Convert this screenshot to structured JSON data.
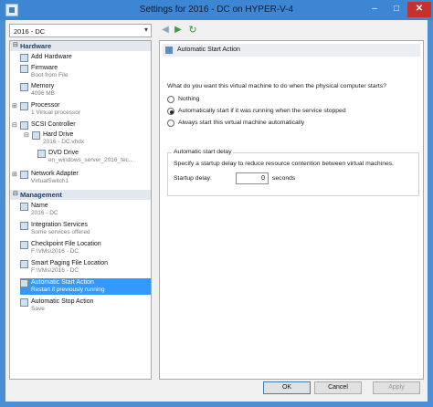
{
  "window": {
    "title": "Settings for 2016 - DC on HYPER-V-4",
    "minimize": "–",
    "maximize": "□",
    "close": "✕"
  },
  "vm_selector": {
    "value": "2016 - DC",
    "arrow": "▾"
  },
  "nav": {
    "back": "◀",
    "forward": "▶",
    "refresh": "↻"
  },
  "tree": {
    "hardware_header": "Hardware",
    "management_header": "Management",
    "collapse_glyph": "⊟",
    "expand_glyph": "⊞",
    "hardware": [
      {
        "title": "Add Hardware",
        "sub": ""
      },
      {
        "title": "Firmware",
        "sub": "Boot from File"
      },
      {
        "title": "Memory",
        "sub": "4096 MB"
      },
      {
        "title": "Processor",
        "sub": "1 Virtual processor"
      },
      {
        "title": "SCSI Controller",
        "sub": ""
      },
      {
        "title": "Hard Drive",
        "sub": "2016 - DC.vhdx"
      },
      {
        "title": "DVD Drive",
        "sub": "en_windows_server_2016_tec..."
      },
      {
        "title": "Network Adapter",
        "sub": "VirtualSwitch1"
      }
    ],
    "management": [
      {
        "title": "Name",
        "sub": "2016 - DC"
      },
      {
        "title": "Integration Services",
        "sub": "Some services offered"
      },
      {
        "title": "Checkpoint File Location",
        "sub": "F:\\VMs\\2016 - DC"
      },
      {
        "title": "Smart Paging File Location",
        "sub": "F:\\VMs\\2016 - DC"
      },
      {
        "title": "Automatic Start Action",
        "sub": "Restart if previously running"
      },
      {
        "title": "Automatic Stop Action",
        "sub": "Save"
      }
    ]
  },
  "panel": {
    "header": "Automatic Start Action",
    "question": "What do you want this virtual machine to do when the physical computer starts?",
    "options": [
      {
        "label": "Nothing",
        "selected": false
      },
      {
        "label": "Automatically start if it was running when the service stopped",
        "selected": true
      },
      {
        "label": "Always start this virtual machine automatically",
        "selected": false
      }
    ],
    "delay_group_title": "Automatic start delay",
    "delay_desc": "Specify a startup delay to reduce resource contention between virtual machines.",
    "delay_label": "Startup delay:",
    "delay_value": "0",
    "delay_unit": "seconds"
  },
  "buttons": {
    "ok": "OK",
    "cancel": "Cancel",
    "apply": "Apply"
  },
  "colors": {
    "titlebar": "#3d86d3",
    "selection": "#3399ff",
    "close": "#c7312b"
  }
}
